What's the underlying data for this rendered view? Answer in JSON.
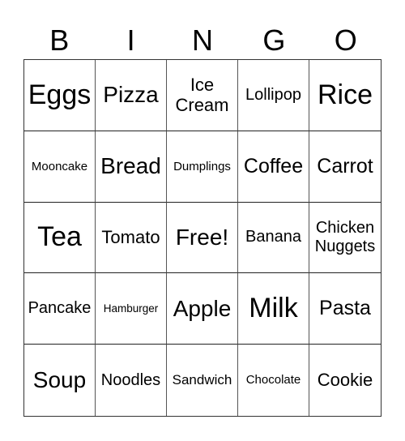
{
  "header": {
    "letters": [
      "B",
      "I",
      "N",
      "G",
      "O"
    ]
  },
  "grid": {
    "rows": [
      [
        {
          "text": "Eggs",
          "size": "s34"
        },
        {
          "text": "Pizza",
          "size": "s28"
        },
        {
          "text": "Ice Cream",
          "size": "s22"
        },
        {
          "text": "Lollipop",
          "size": "s20"
        },
        {
          "text": "Rice",
          "size": "s34"
        }
      ],
      [
        {
          "text": "Mooncake",
          "size": "s15"
        },
        {
          "text": "Bread",
          "size": "s28"
        },
        {
          "text": "Dumplings",
          "size": "s15"
        },
        {
          "text": "Coffee",
          "size": "s25"
        },
        {
          "text": "Carrot",
          "size": "s25"
        }
      ],
      [
        {
          "text": "Tea",
          "size": "s34"
        },
        {
          "text": "Tomato",
          "size": "s22"
        },
        {
          "text": "Free!",
          "size": "s28"
        },
        {
          "text": "Banana",
          "size": "s20"
        },
        {
          "text": "Chicken Nuggets",
          "size": "s20"
        }
      ],
      [
        {
          "text": "Pancake",
          "size": "s20"
        },
        {
          "text": "Hamburger",
          "size": "s13"
        },
        {
          "text": "Apple",
          "size": "s28"
        },
        {
          "text": "Milk",
          "size": "s34"
        },
        {
          "text": "Pasta",
          "size": "s25"
        }
      ],
      [
        {
          "text": "Soup",
          "size": "s28"
        },
        {
          "text": "Noodles",
          "size": "s20"
        },
        {
          "text": "Sandwich",
          "size": "s17"
        },
        {
          "text": "Chocolate",
          "size": "s15"
        },
        {
          "text": "Cookie",
          "size": "s22"
        }
      ]
    ]
  }
}
